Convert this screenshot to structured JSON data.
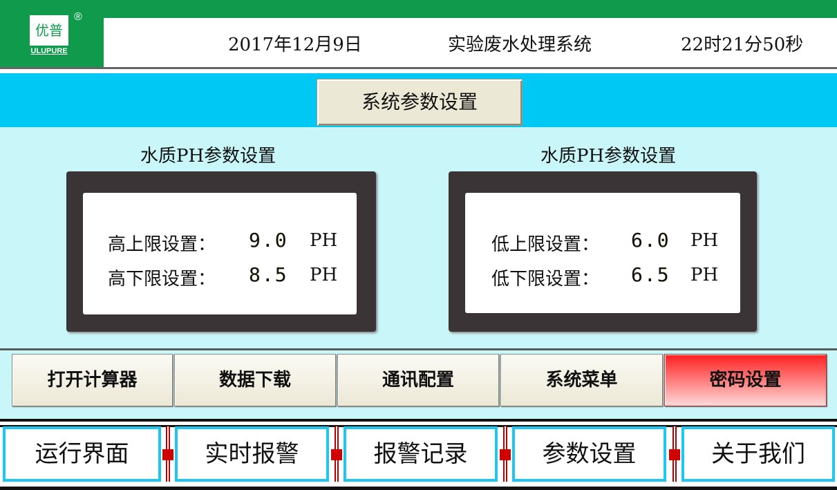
{
  "header": {
    "logo_text": "优普",
    "logo_sub": "ULUPURE",
    "logo_reg": "®",
    "date": "2017年12月9日",
    "system_title": "实验废水处理系统",
    "time": "22时21分50秒"
  },
  "section_title": "系统参数设置",
  "panels": {
    "left": {
      "heading": "水质PH参数设置",
      "rows": [
        {
          "label": "高上限设置：",
          "value": "9.0",
          "unit": "PH"
        },
        {
          "label": "高下限设置：",
          "value": "8.5",
          "unit": "PH"
        }
      ]
    },
    "right": {
      "heading": "水质PH参数设置",
      "rows": [
        {
          "label": "低上限设置：",
          "value": "6.0",
          "unit": "PH"
        },
        {
          "label": "低下限设置：",
          "value": "6.5",
          "unit": "PH"
        }
      ]
    }
  },
  "function_buttons": {
    "calculator": "打开计算器",
    "download": "数据下载",
    "communication": "通讯配置",
    "system_menu": "系统菜单",
    "password": "密码设置"
  },
  "nav": {
    "run": "运行界面",
    "realtime_alarm": "实时报警",
    "alarm_records": "报警记录",
    "param_settings": "参数设置",
    "about_us": "关于我们"
  },
  "colors": {
    "brand_green": "#0f9a4c",
    "title_bar_cyan": "#00c8f5",
    "content_bg": "#c9f6f9",
    "panel_frame": "#3b3437",
    "password_red": "#ff1f1f",
    "nav_border": "#1ec7ef"
  }
}
